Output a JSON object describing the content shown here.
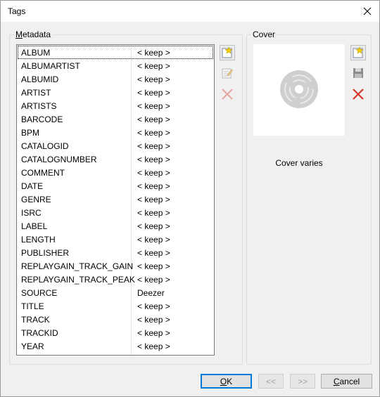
{
  "window": {
    "title": "Tags"
  },
  "metadata": {
    "label_first": "M",
    "label_rest": "etadata",
    "rows": [
      {
        "name": "ALBUM",
        "value": "< keep >"
      },
      {
        "name": "ALBUMARTIST",
        "value": "< keep >"
      },
      {
        "name": "ALBUMID",
        "value": "< keep >"
      },
      {
        "name": "ARTIST",
        "value": "< keep >"
      },
      {
        "name": "ARTISTS",
        "value": "< keep >"
      },
      {
        "name": "BARCODE",
        "value": "< keep >"
      },
      {
        "name": "BPM",
        "value": "< keep >"
      },
      {
        "name": "CATALOGID",
        "value": "< keep >"
      },
      {
        "name": "CATALOGNUMBER",
        "value": "< keep >"
      },
      {
        "name": "COMMENT",
        "value": "< keep >"
      },
      {
        "name": "DATE",
        "value": "< keep >"
      },
      {
        "name": "GENRE",
        "value": "< keep >"
      },
      {
        "name": "ISRC",
        "value": "< keep >"
      },
      {
        "name": "LABEL",
        "value": "< keep >"
      },
      {
        "name": "LENGTH",
        "value": "< keep >"
      },
      {
        "name": "PUBLISHER",
        "value": "< keep >"
      },
      {
        "name": "REPLAYGAIN_TRACK_GAIN",
        "value": "< keep >"
      },
      {
        "name": "REPLAYGAIN_TRACK_PEAK",
        "value": "< keep >"
      },
      {
        "name": "SOURCE",
        "value": "Deezer"
      },
      {
        "name": "TITLE",
        "value": "< keep >"
      },
      {
        "name": "TRACK",
        "value": "< keep >"
      },
      {
        "name": "TRACKID",
        "value": "< keep >"
      },
      {
        "name": "YEAR",
        "value": "< keep >"
      }
    ],
    "tools": [
      "new-tag-icon",
      "edit-tag-icon",
      "delete-tag-icon"
    ]
  },
  "cover": {
    "label": "Cover",
    "status": "Cover varies",
    "tools": [
      "load-cover-icon",
      "save-cover-icon",
      "delete-cover-icon"
    ]
  },
  "buttons": {
    "ok_first": "O",
    "ok_rest": "K",
    "prev": "<<",
    "next": ">>",
    "cancel_first": "C",
    "cancel_rest": "ancel"
  },
  "colors": {
    "focus": "#0078d7",
    "delete": "#d9352a",
    "disabled": "#a0a0a0"
  }
}
